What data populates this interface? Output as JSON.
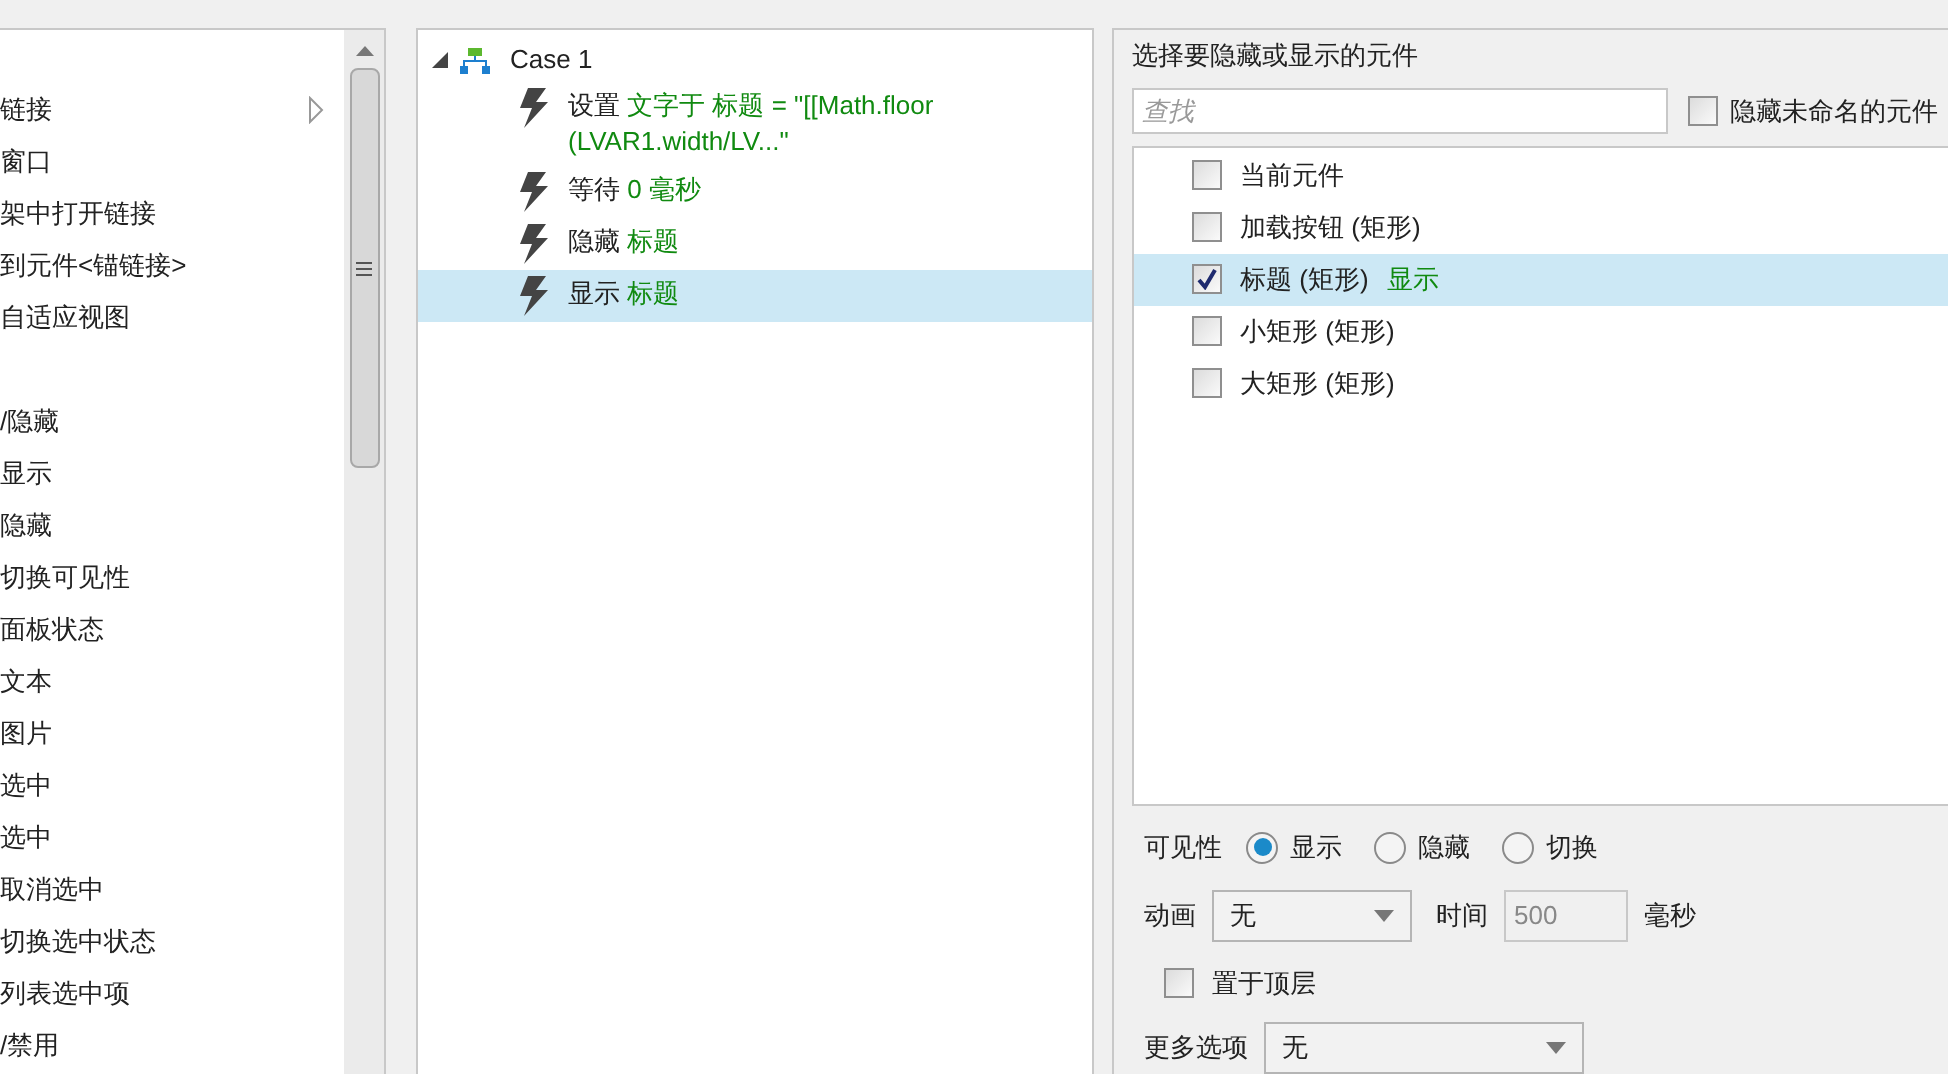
{
  "action_list": {
    "groups": [
      {
        "items": [
          {
            "label": "链接",
            "has_submenu": true
          },
          {
            "label": "窗口",
            "has_submenu": false
          },
          {
            "label": "架中打开链接",
            "has_submenu": false
          },
          {
            "label": "到元件<锚链接>",
            "has_submenu": false
          },
          {
            "label": "自适应视图",
            "has_submenu": false
          }
        ]
      },
      {
        "items": [
          {
            "label": "/隐藏",
            "has_submenu": false
          },
          {
            "label": "显示",
            "has_submenu": false
          },
          {
            "label": "隐藏",
            "has_submenu": false
          },
          {
            "label": "切换可见性",
            "has_submenu": false
          },
          {
            "label": "面板状态",
            "has_submenu": false
          },
          {
            "label": "文本",
            "has_submenu": false
          },
          {
            "label": "图片",
            "has_submenu": false
          },
          {
            "label": "选中",
            "has_submenu": false
          },
          {
            "label": "选中",
            "has_submenu": false
          },
          {
            "label": "取消选中",
            "has_submenu": false
          },
          {
            "label": "切换选中状态",
            "has_submenu": false
          },
          {
            "label": "列表选中项",
            "has_submenu": false
          },
          {
            "label": "/禁用",
            "has_submenu": false
          }
        ]
      }
    ]
  },
  "case_tree": {
    "case": {
      "label": "Case 1",
      "expanded": true
    },
    "actions": [
      {
        "verb": "设置",
        "target": "文字于 标题 = \"[[Math.floor (LVAR1.width/LV...\"",
        "selected": false
      },
      {
        "verb": "等待",
        "target": "0 毫秒",
        "selected": false
      },
      {
        "verb": "隐藏",
        "target": "标题",
        "selected": false
      },
      {
        "verb": "显示",
        "target": "标题",
        "selected": true
      }
    ]
  },
  "config": {
    "heading": "选择要隐藏或显示的元件",
    "search": {
      "placeholder": "查找"
    },
    "hide_unnamed": {
      "label": "隐藏未命名的元件",
      "checked": false
    },
    "widgets": [
      {
        "label": "当前元件",
        "checked": false,
        "selected": false
      },
      {
        "label": "加载按钮 (矩形)",
        "checked": false,
        "selected": false
      },
      {
        "label": "标题 (矩形)",
        "checked": true,
        "selected": true,
        "status": "显示"
      },
      {
        "label": "小矩形 (矩形)",
        "checked": false,
        "selected": false
      },
      {
        "label": "大矩形 (矩形)",
        "checked": false,
        "selected": false
      }
    ],
    "visibility": {
      "label": "可见性",
      "options": [
        {
          "label": "显示",
          "selected": true
        },
        {
          "label": "隐藏",
          "selected": false
        },
        {
          "label": "切换",
          "selected": false
        }
      ]
    },
    "animation": {
      "label": "动画",
      "value": "无"
    },
    "time": {
      "label": "时间",
      "value": "500",
      "disabled": true,
      "unit": "毫秒"
    },
    "bring_to_front": {
      "label": "置于顶层",
      "checked": false
    },
    "more_options": {
      "label": "更多选项",
      "value": "无"
    }
  }
}
